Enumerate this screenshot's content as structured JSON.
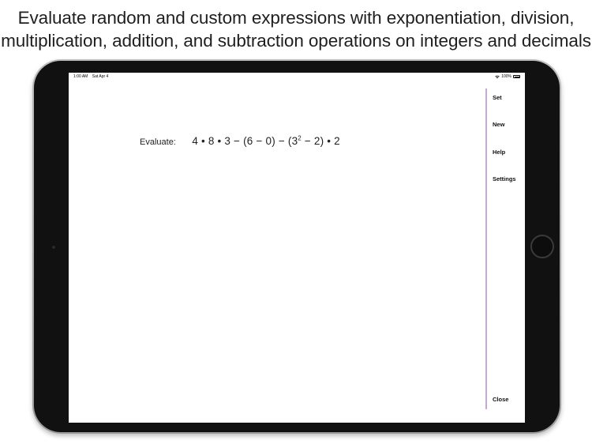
{
  "caption": {
    "line1": "Evaluate random and custom expressions with exponentiation, division,",
    "line2": "multiplication, addition, and subtraction operations on integers and decimals"
  },
  "status_bar": {
    "time": "1:00 AM",
    "date": "Sat Apr 4",
    "battery_percent": "100%"
  },
  "problem": {
    "label": "Evaluate:",
    "expression_part1": "4 • 8 • 3 − (6 − 0) − (3",
    "exponent": "2",
    "expression_part2": " − 2) • 2"
  },
  "sidebar": {
    "set": "Set",
    "new": "New",
    "help": "Help",
    "settings": "Settings",
    "close": "Close"
  },
  "colors": {
    "divider": "#c8a8d8",
    "device_frame": "#111111"
  }
}
